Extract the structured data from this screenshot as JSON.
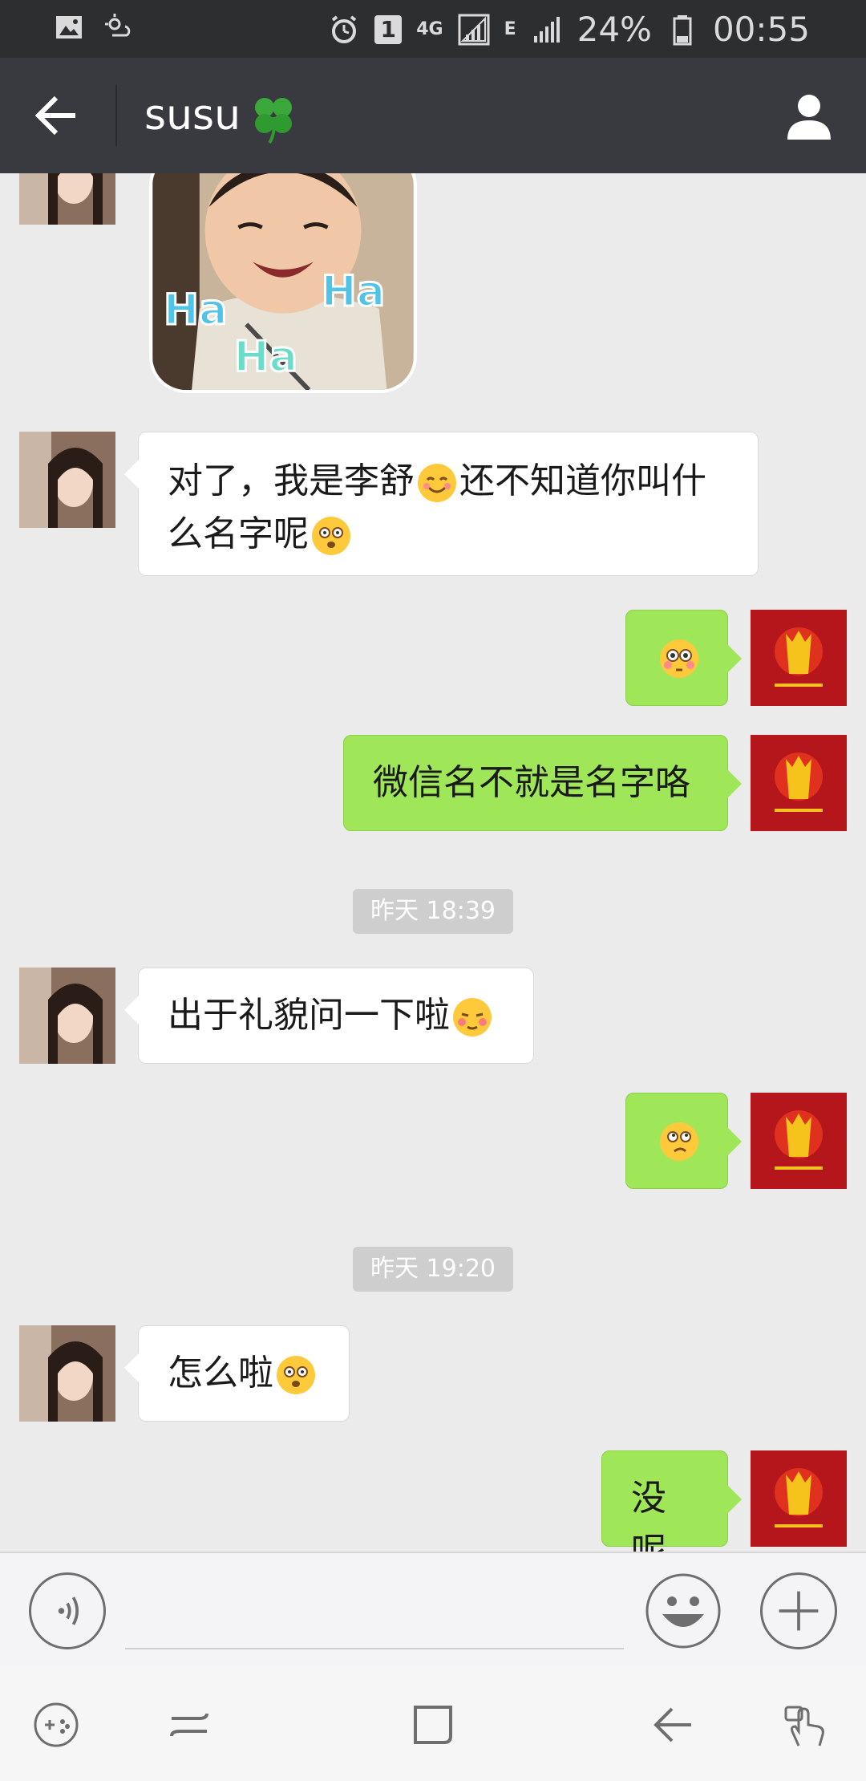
{
  "status_bar": {
    "network_type": "4G",
    "network_type_2": "E",
    "sim_badge": "1",
    "battery": "24%",
    "time": "00:55"
  },
  "header": {
    "title": "susu",
    "title_icon": "four-leaf-clover-icon",
    "back_icon": "back-arrow-icon",
    "profile_icon": "profile-icon"
  },
  "messages": [
    {
      "side": "left",
      "type": "sticker",
      "sticker_text": "Ha Ha Ha"
    },
    {
      "side": "left",
      "type": "text",
      "text_a": "对了，我是李舒",
      "text_b": "还不知道你叫什么名字呢"
    },
    {
      "side": "right",
      "type": "emoji",
      "emoji": "flushed-emoji"
    },
    {
      "side": "right",
      "type": "text",
      "text": "微信名不就是名字咯"
    },
    {
      "type": "timestamp",
      "text": "昨天 18:39"
    },
    {
      "side": "left",
      "type": "text",
      "text": "出于礼貌问一下啦"
    },
    {
      "side": "right",
      "type": "emoji",
      "emoji": "confused-emoji"
    },
    {
      "type": "timestamp",
      "text": "昨天 19:20"
    },
    {
      "side": "left",
      "type": "text",
      "text": "怎么啦"
    },
    {
      "side": "right",
      "type": "text",
      "text": "没呢"
    }
  ],
  "input_bar": {
    "voice_icon": "voice-icon",
    "message_value": "",
    "emoji_icon": "emoji-icon",
    "plus_icon": "plus-icon"
  },
  "nav_bar": {
    "icons": [
      "game-tools-icon",
      "recent-apps-icon",
      "home-icon",
      "back-icon",
      "assist-touch-icon"
    ]
  },
  "colors": {
    "header_bg": "#393a3f",
    "status_bg": "#2d2e30",
    "chat_bg": "#ebebeb",
    "sent_bubble": "#9fe658",
    "received_bubble": "#ffffff",
    "timestamp_bg": "#cecece"
  }
}
